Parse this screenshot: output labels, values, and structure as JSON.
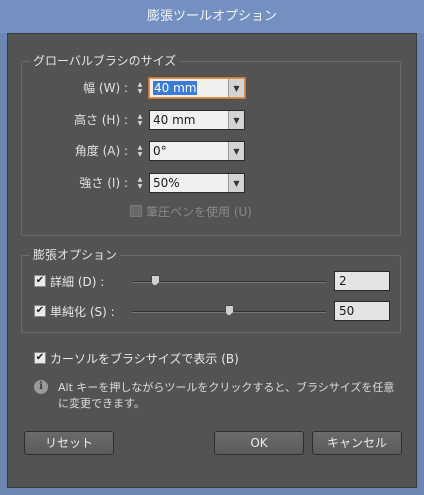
{
  "window": {
    "title": "膨張ツールオプション"
  },
  "global_brush": {
    "title": "グローバルブラシのサイズ",
    "fields": [
      {
        "label": "幅 (W) :",
        "value": "40 mm"
      },
      {
        "label": "高さ (H) :",
        "value": "40 mm"
      },
      {
        "label": "角度 (A) :",
        "value": "0°"
      },
      {
        "label": "強さ (I) :",
        "value": "50%"
      }
    ],
    "pressure_pen": {
      "label": "筆圧ペンを使用 (U)",
      "checked": false,
      "enabled": false
    }
  },
  "bloat_options": {
    "title": "膨張オプション",
    "detail": {
      "label": "詳細 (D) :",
      "checked": true,
      "value": "2",
      "level": 0.1
    },
    "simplify": {
      "label": "単純化 (S) :",
      "checked": true,
      "value": "50",
      "level": 0.5
    }
  },
  "show_brush_size": {
    "label": "カーソルをブラシサイズで表示 (B)",
    "checked": true
  },
  "info": {
    "icon": "info-icon",
    "text": "Alt キーを押しながらツールをクリックすると、ブラシサイズを任意に変更できます。"
  },
  "buttons": {
    "reset": "リセット",
    "ok": "OK",
    "cancel": "キャンセル"
  },
  "glyphs": {
    "check": "✔",
    "spin_up": "▲",
    "spin_down": "▼",
    "dropdown": "▼",
    "info": "i"
  },
  "colors": {
    "titlebar": "#7390c1",
    "panel": "#535353",
    "focus": "#e0904a",
    "selection": "#3a7bd5"
  }
}
